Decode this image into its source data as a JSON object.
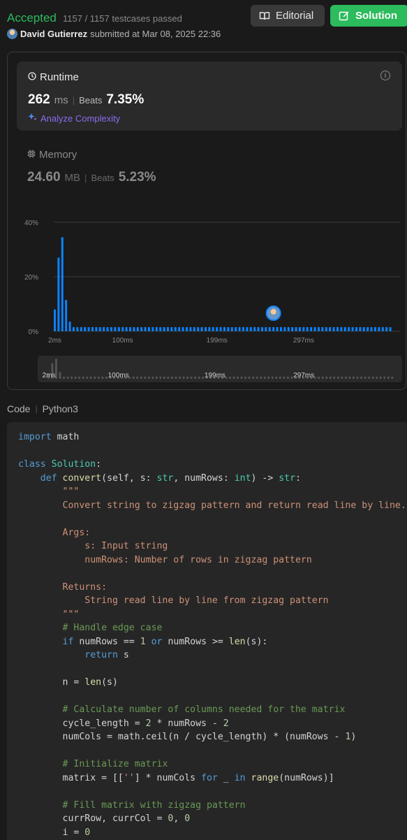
{
  "submission": {
    "status": "Accepted",
    "testcases": "1157 / 1157 testcases passed",
    "author": "David Gutierrez",
    "submitted_text": "submitted at Mar 08, 2025 22:36"
  },
  "buttons": {
    "editorial": "Editorial",
    "solution": "Solution"
  },
  "runtime": {
    "title": "Runtime",
    "value": "262",
    "unit": "ms",
    "beats_label": "Beats",
    "beats": "7.35%",
    "analyze": "Analyze Complexity"
  },
  "memory": {
    "title": "Memory",
    "value": "24.60",
    "unit": "MB",
    "beats_label": "Beats",
    "beats": "5.23%"
  },
  "chart_data": {
    "type": "bar",
    "y_ticks": [
      "40%",
      "20%",
      "0%"
    ],
    "ylim": [
      0,
      40
    ],
    "x_ticks": [
      "2ms",
      "100ms",
      "199ms",
      "297ms"
    ],
    "values": [
      8,
      27,
      34.5,
      11.5,
      3.5,
      1.5,
      1.5,
      1.5,
      1.5,
      1.5,
      1.5,
      1.5,
      1.5,
      1.5,
      1.5,
      1.5,
      1.5,
      1.5,
      1.5,
      1.5,
      1.5,
      1.5,
      1.5,
      1.5,
      1.5,
      1.5,
      1.5,
      1.5,
      1.5,
      1.5,
      1.5,
      1.5,
      1.5,
      1.5,
      1.5,
      1.5,
      1.5,
      1.5,
      1.5,
      1.5,
      1.5,
      1.5,
      1.5,
      1.5,
      1.5,
      1.5,
      1.5,
      1.5,
      1.5,
      1.5,
      1.5,
      1.5,
      1.5,
      1.5,
      1.5,
      1.5,
      1.5,
      1.5,
      1.5,
      1.5,
      1.5,
      1.5,
      1.5,
      1.5,
      1.5,
      1.5,
      1.5,
      1.5,
      1.5,
      1.5,
      1.5,
      1.5,
      1.5,
      1.5,
      1.5,
      1.5,
      1.5,
      1.5,
      1.5,
      1.5,
      1.5,
      1.5,
      1.5,
      1.5,
      1.5,
      1.5,
      1.5,
      1.5,
      1.5,
      1.5
    ],
    "marker_index": 58,
    "grid": true,
    "bar_color": "#0a84ff"
  },
  "code": {
    "label": "Code",
    "language": "Python3"
  },
  "colors": {
    "accepted": "#2cbb5d",
    "bar": "#0a84ff",
    "analyze": "#8b6cf0"
  }
}
